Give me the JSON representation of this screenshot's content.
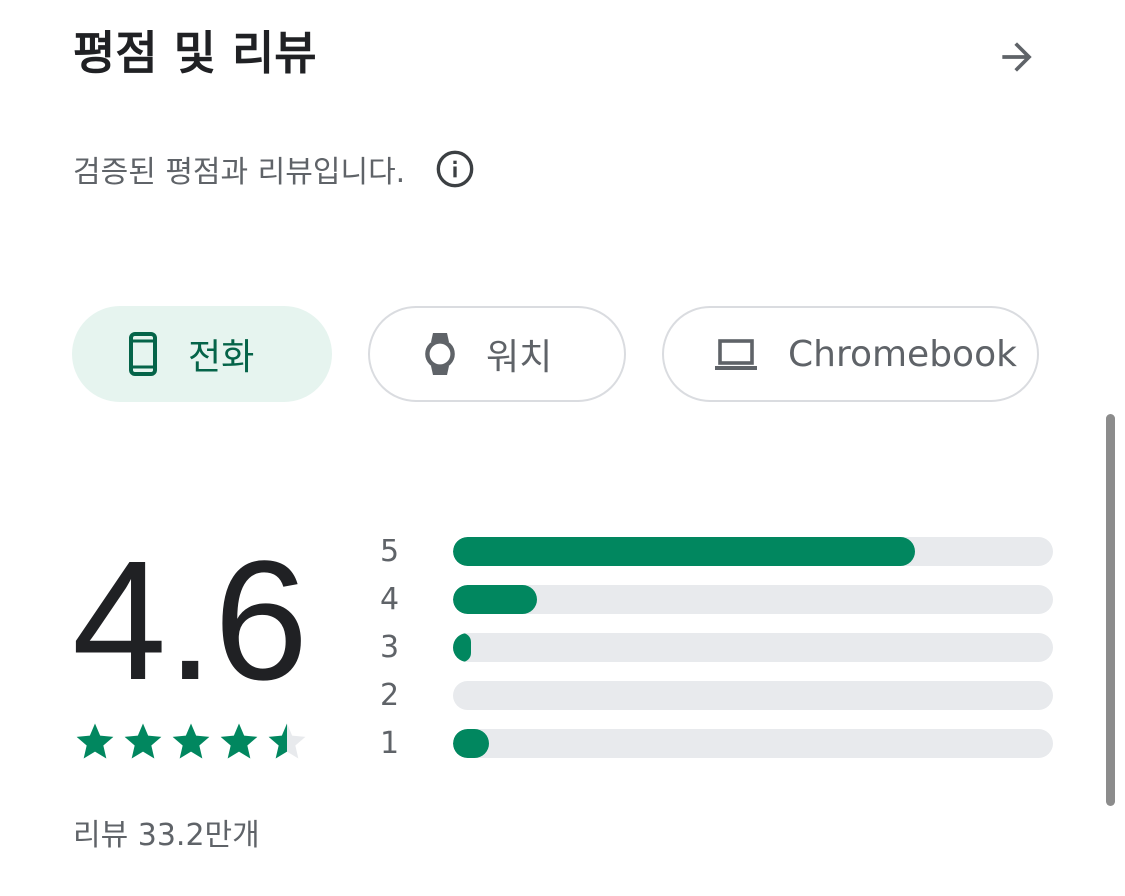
{
  "header": {
    "title": "평점 및 리뷰",
    "arrow_icon": "arrow-right-icon"
  },
  "verification": {
    "text": "검증된 평점과 리뷰입니다.",
    "info_icon": "info-icon"
  },
  "device_chips": [
    {
      "label": "전화",
      "icon": "phone-icon",
      "selected": true
    },
    {
      "label": "워치",
      "icon": "watch-icon",
      "selected": false
    },
    {
      "label": "Chromebook",
      "icon": "laptop-icon",
      "selected": false
    }
  ],
  "rating": {
    "average": "4.6",
    "stars": 4.6,
    "review_count": "리뷰 33.2만개"
  },
  "distribution": [
    {
      "label": "5",
      "fraction": 0.77
    },
    {
      "label": "4",
      "fraction": 0.14
    },
    {
      "label": "3",
      "fraction": 0.03
    },
    {
      "label": "2",
      "fraction": 0.0
    },
    {
      "label": "1",
      "fraction": 0.06
    }
  ],
  "colors": {
    "accent_green": "#01875f",
    "chip_selected_bg": "#e6f4ef",
    "chip_selected_text": "#056449",
    "track_gray": "#e8eaed",
    "text_secondary": "#5f6368"
  }
}
